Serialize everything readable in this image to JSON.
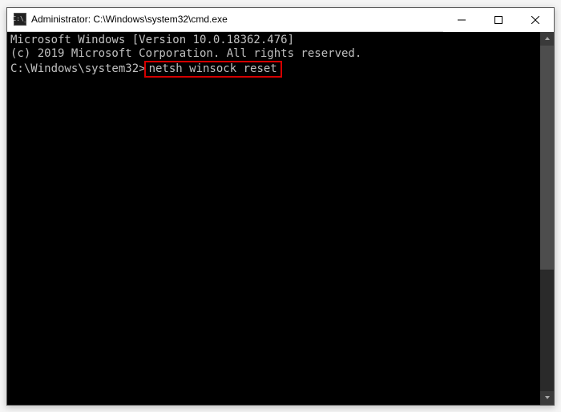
{
  "window": {
    "title": "Administrator: C:\\Windows\\system32\\cmd.exe",
    "icon_label": "C:\\_"
  },
  "terminal": {
    "line1": "Microsoft Windows [Version 10.0.18362.476]",
    "line2": "(c) 2019 Microsoft Corporation. All rights reserved.",
    "blank": "",
    "prompt": "C:\\Windows\\system32>",
    "command": "netsh winsock reset"
  },
  "controls": {
    "minimize": "minimize",
    "maximize": "maximize",
    "close": "close"
  }
}
